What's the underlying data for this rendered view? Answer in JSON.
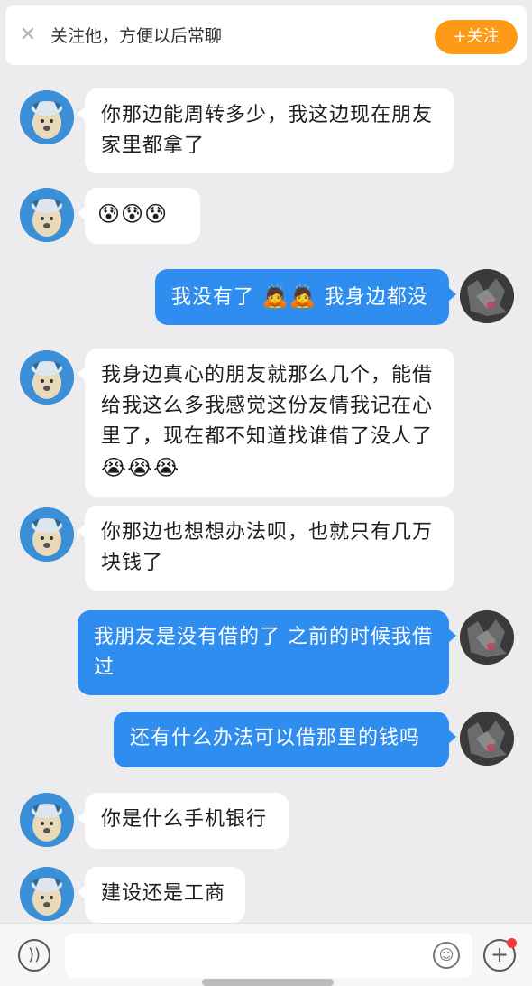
{
  "header": {
    "close_icon": "close-icon",
    "follow_tip": "关注他，方便以后常聊",
    "follow_button": "+关注",
    "accent_color": "#ff9a16"
  },
  "messages": [
    {
      "side": "in",
      "text": "你那边能周转多少，我这边现在朋友家里都拿了"
    },
    {
      "side": "in",
      "emoji": [
        "😰",
        "😰",
        "😰"
      ],
      "emoji_name": "crying-sweat-emoji"
    },
    {
      "side": "out",
      "text": "我没有了",
      "emoji": [
        "🙇",
        "🙇"
      ],
      "text2": "我身边都没"
    },
    {
      "side": "in",
      "text": "我身边真心的朋友就那么几个，能借给我这么多我感觉这份友情我记在心里了，现在都不知道找谁借了没人了",
      "emoji": [
        "😭",
        "😭",
        "😭"
      ]
    },
    {
      "side": "in",
      "text": "你那边也想想办法呗，也就只有几万块钱了"
    },
    {
      "side": "out",
      "text": "我朋友是没有借的了 之前的时候我借过"
    },
    {
      "side": "out",
      "text": "还有什么办法可以借那里的钱吗"
    },
    {
      "side": "in",
      "text": "你是什么手机银行"
    },
    {
      "side": "in",
      "text": "建设还是工商"
    }
  ],
  "colors": {
    "incoming_bubble": "#ffffff",
    "outgoing_bubble": "#2f8df0",
    "background": "#ececee"
  },
  "bottombar": {
    "voice_icon": "voice-icon",
    "emoji_icon": "smile-icon",
    "plus_icon": "plus-icon"
  }
}
